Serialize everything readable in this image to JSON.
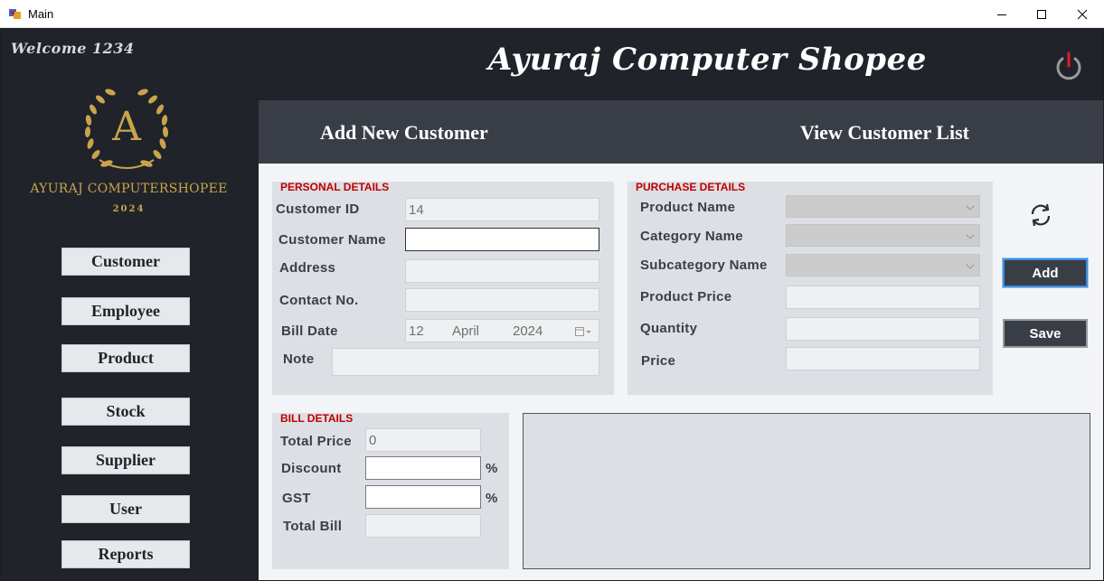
{
  "window": {
    "title": "Main"
  },
  "sidebar": {
    "welcome": "Welcome 1234",
    "brand_name": "AYURAJ COMPUTERSHOPEE",
    "brand_year": "2024",
    "logo_letter": "A",
    "nav": [
      "Customer",
      "Employee",
      "Product",
      "Stock",
      "Supplier",
      "User",
      "Reports"
    ]
  },
  "header": {
    "title": "Ayuraj Computer Shopee"
  },
  "tabs": {
    "add": "Add New Customer",
    "view": "View Customer List"
  },
  "personal": {
    "title": "PERSONAL DETAILS",
    "customer_id_label": "Customer ID",
    "customer_id_value": "14",
    "customer_name_label": "Customer Name",
    "address_label": "Address",
    "contact_label": "Contact No.",
    "bill_date_label": "Bill Date",
    "bill_date_day": "12",
    "bill_date_month": "April",
    "bill_date_year": "2024",
    "note_label": "Note"
  },
  "purchase": {
    "title": "PURCHASE DETAILS",
    "product_name_label": "Product Name",
    "category_label": "Category Name",
    "subcategory_label": "Subcategory Name",
    "price_label": "Product Price",
    "quantity_label": "Quantity",
    "total_price_label": "Price"
  },
  "actions": {
    "add": "Add",
    "save": "Save"
  },
  "bill": {
    "title": "BILL DETAILS",
    "total_price_label": "Total Price",
    "total_price_value": "0",
    "discount_label": "Discount",
    "gst_label": "GST",
    "total_bill_label": "Total Bill",
    "percent": "%"
  },
  "colors": {
    "sidebar_bg": "#20232a",
    "tab_bg": "#393e46",
    "gold": "#c9a44c",
    "group_title": "#c00000"
  }
}
